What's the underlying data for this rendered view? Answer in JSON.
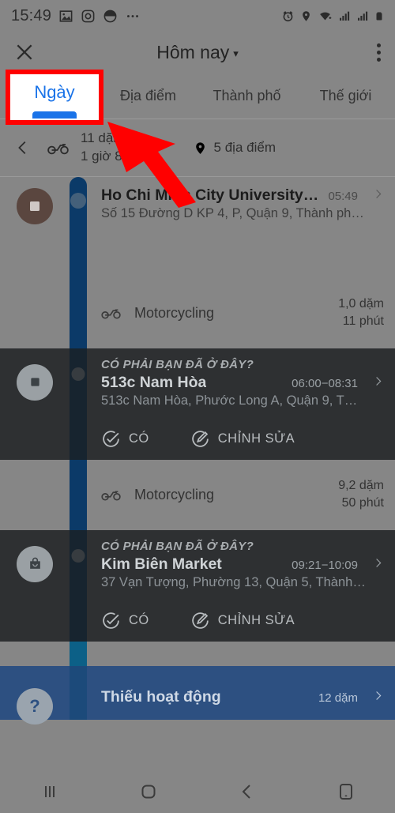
{
  "status_bar": {
    "time": "15:49",
    "left_icons": [
      "image-icon",
      "instagram-icon",
      "dark-mode-icon",
      "more-icon"
    ],
    "right_icons": [
      "alarm-icon",
      "location-icon",
      "wifi-icon",
      "signal-icon",
      "signal-icon",
      "battery-icon"
    ]
  },
  "app_bar": {
    "close_label": "✕",
    "title": "Hôm nay",
    "caret": "▾",
    "overflow_label": "more-options"
  },
  "tabs": [
    {
      "label": "Ngày",
      "active": true
    },
    {
      "label": "Địa điểm",
      "active": false
    },
    {
      "label": "Thành phố",
      "active": false
    },
    {
      "label": "Thế giới",
      "active": false
    }
  ],
  "summary": {
    "distance": "11 dặm",
    "duration": "1 giờ 8 phút",
    "places": "5 địa điểm"
  },
  "timeline": [
    {
      "kind": "place",
      "theme": "light",
      "badge": "stop-icon",
      "badge_color": "#5a463f",
      "title": "Ho Chi Minh City University…",
      "time": "05:49",
      "address": "Số 15 Đường D KP 4, P, Quận 9, Thành ph…"
    },
    {
      "kind": "travel",
      "theme": "light",
      "mode": "Motorcycling",
      "distance": "1,0 dặm",
      "duration": "11 phút"
    },
    {
      "kind": "confirm",
      "theme": "dark",
      "badge": "stop-icon",
      "badge_color": "#9aa0a4",
      "question": "CÓ PHẢI BẠN ĐÃ Ở ĐÂY?",
      "title": "513c Nam Hòa",
      "time": "06:00−08:31",
      "address": "513c Nam Hòa, Phước Long A, Quận 9, T…",
      "confirm_label": "CÓ",
      "edit_label": "CHỈNH SỬA"
    },
    {
      "kind": "travel",
      "theme": "light",
      "mode": "Motorcycling",
      "distance": "9,2 dặm",
      "duration": "50 phút"
    },
    {
      "kind": "confirm",
      "theme": "dark",
      "badge": "shopping-bag-icon",
      "badge_color": "#9aa0a4",
      "question": "CÓ PHẢI BẠN ĐÃ Ở ĐÂY?",
      "title": "Kim Biên Market",
      "time": "09:21−10:09",
      "address": "37 Vạn Tượng, Phường 13, Quận 5, Thành…",
      "confirm_label": "CÓ",
      "edit_label": "CHỈNH SỬA"
    },
    {
      "kind": "missing",
      "theme": "blue",
      "badge": "question-icon",
      "title": "Thiếu hoạt động",
      "time": "12 dặm"
    }
  ],
  "annotation": {
    "highlight_tab": "Ngày",
    "box_color": "#ff0000",
    "arrow_color": "#ff0000"
  },
  "nav_bar": {
    "items": [
      "recents-icon",
      "home-icon",
      "back-icon",
      "device-icon"
    ]
  },
  "colors": {
    "accent": "#1a73e8",
    "dark_card": "#2e3032",
    "blue_card": "#2d5081",
    "rail": "#0b3a68",
    "dim": "#868686"
  }
}
